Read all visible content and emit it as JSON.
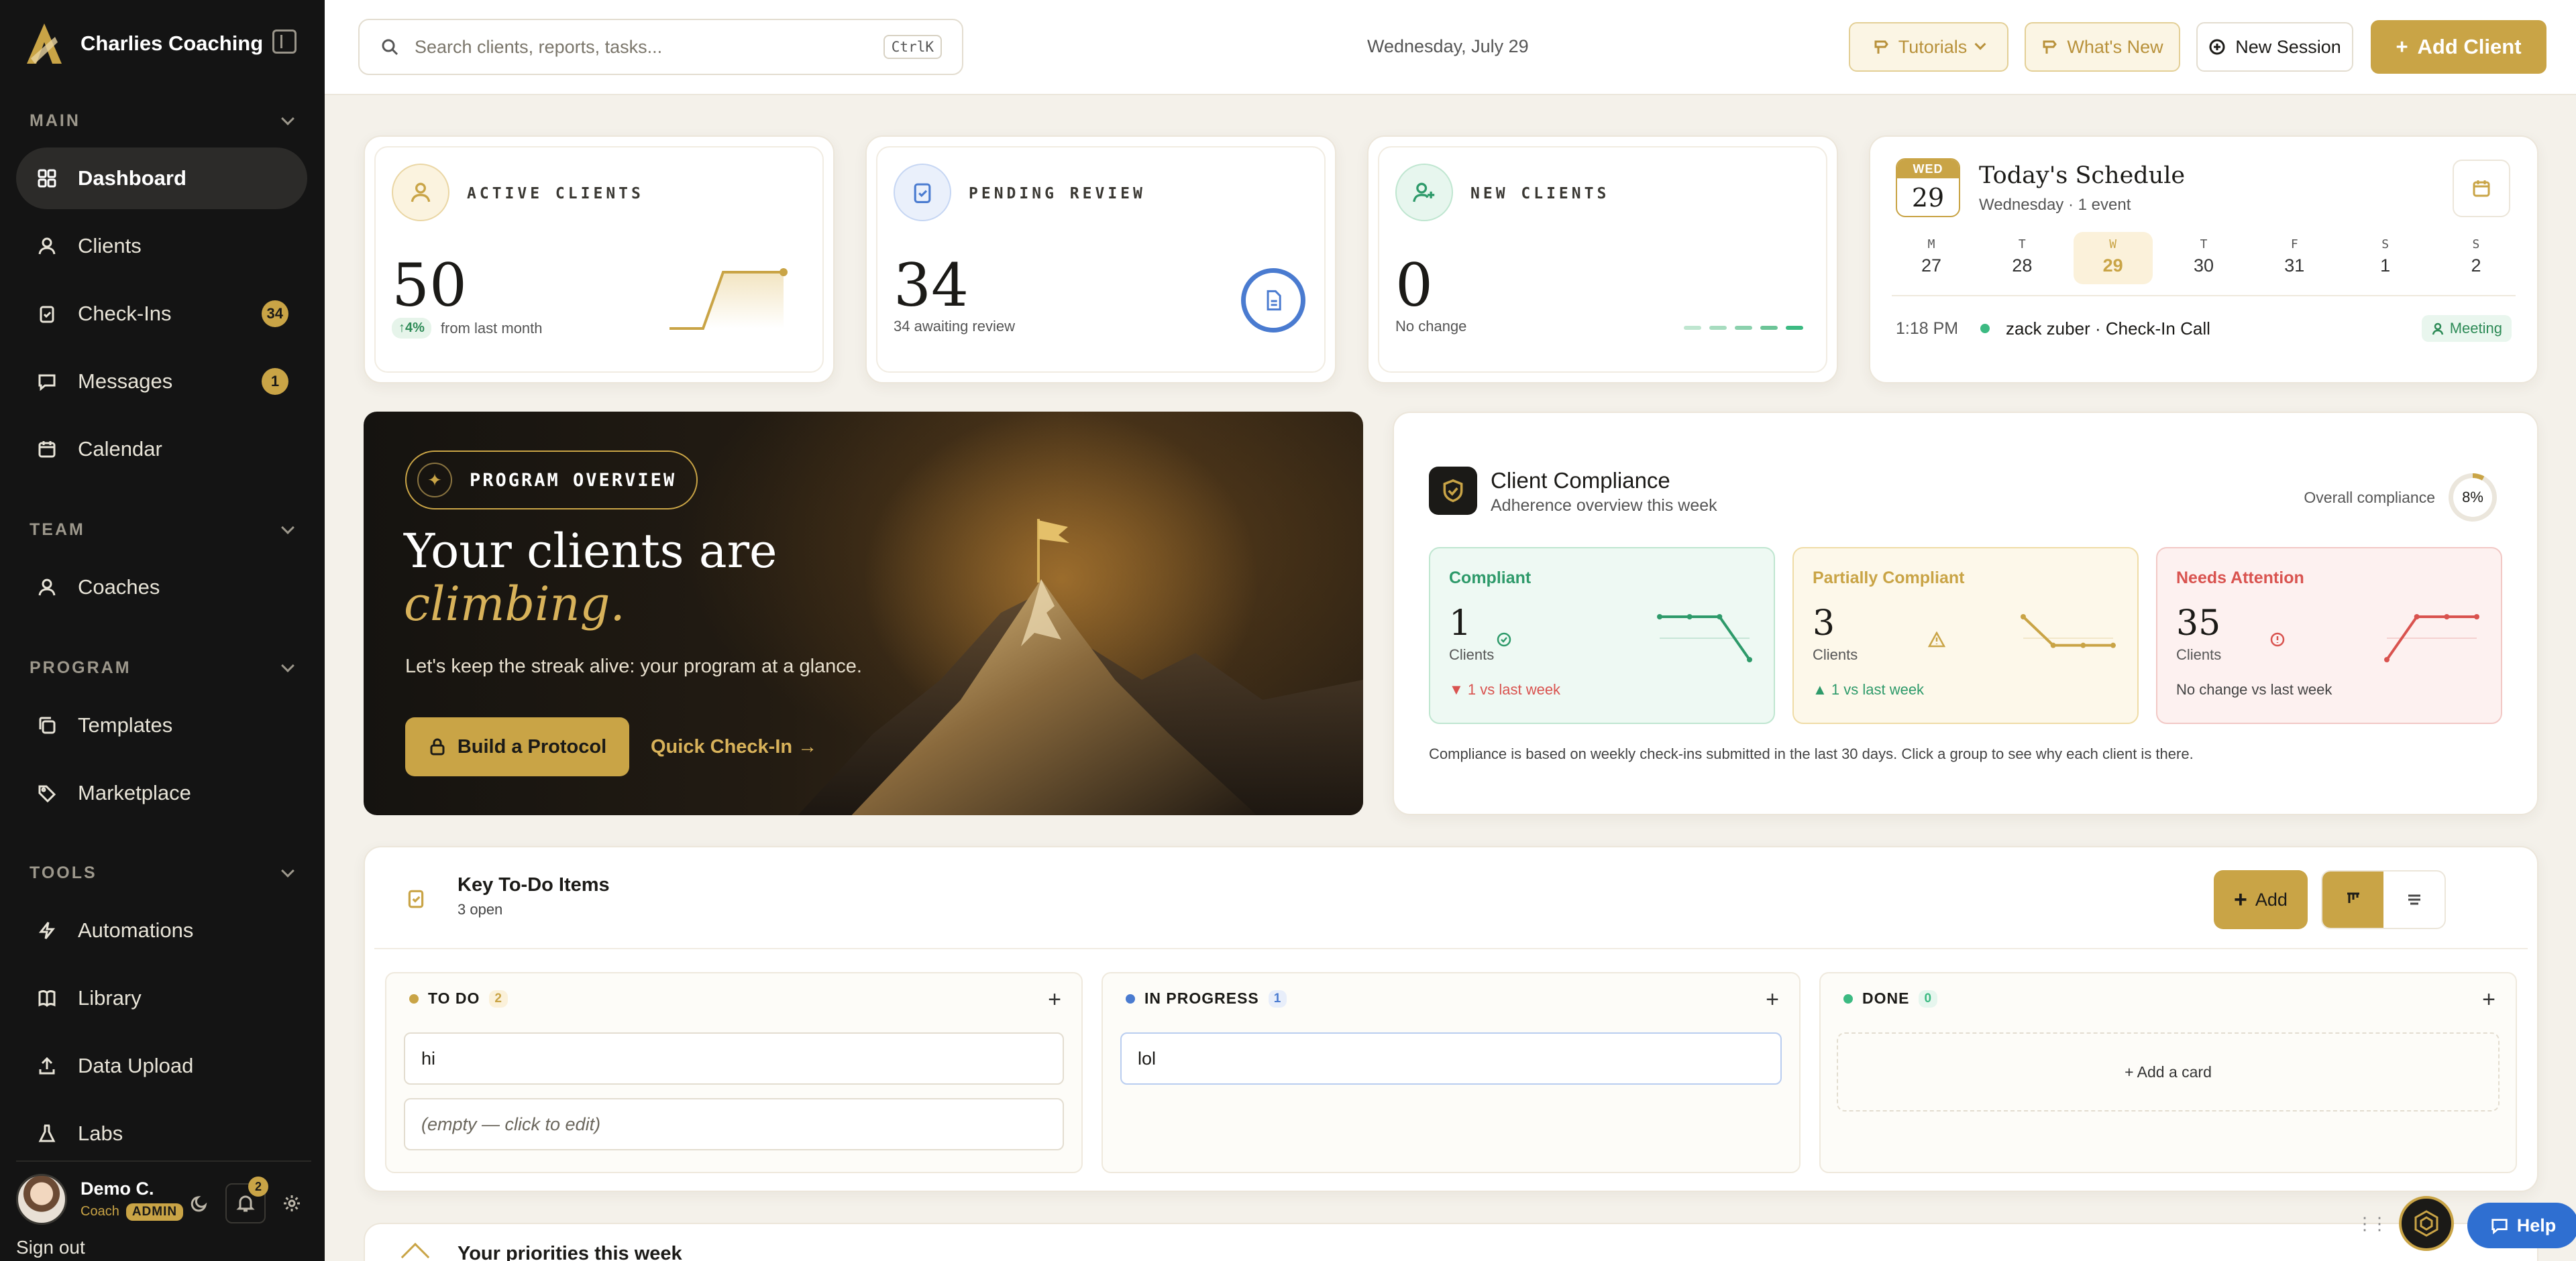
{
  "app": {
    "name": "Charlies Coaching"
  },
  "sidebar": {
    "sections": [
      {
        "title": "MAIN"
      },
      {
        "title": "TEAM"
      },
      {
        "title": "PROGRAM"
      },
      {
        "title": "TOOLS"
      }
    ],
    "items": [
      {
        "label": "Dashboard",
        "icon": "grid-icon",
        "active": true
      },
      {
        "label": "Clients",
        "icon": "users-icon"
      },
      {
        "label": "Check-Ins",
        "icon": "clipboard-check-icon",
        "badge": "34"
      },
      {
        "label": "Messages",
        "icon": "chat-icon",
        "badge": "1"
      },
      {
        "label": "Calendar",
        "icon": "calendar-icon"
      },
      {
        "label": "Coaches",
        "icon": "users-icon"
      },
      {
        "label": "Templates",
        "icon": "copy-icon"
      },
      {
        "label": "Marketplace",
        "icon": "tag-icon"
      },
      {
        "label": "Automations",
        "icon": "lightning-icon"
      },
      {
        "label": "Library",
        "icon": "book-icon"
      },
      {
        "label": "Data Upload",
        "icon": "upload-icon"
      },
      {
        "label": "Labs",
        "icon": "flask-icon"
      }
    ],
    "user": {
      "name": "Demo C.",
      "role": "Coach",
      "badge": "ADMIN",
      "notifications": "2"
    },
    "sign_out": "Sign out"
  },
  "topbar": {
    "search_placeholder": "Search clients, reports, tasks...",
    "shortcut": "CtrlK",
    "date": "Wednesday, July 29",
    "tutorials": "Tutorials",
    "whats_new": "What's New",
    "new_session": "New Session",
    "add_client": "Add Client"
  },
  "stats": [
    {
      "label": "ACTIVE CLIENTS",
      "value": "50",
      "trend": "↑4%",
      "sub": "from last month",
      "icon": "users-icon",
      "accent": "#c9a446"
    },
    {
      "label": "PENDING REVIEW",
      "value": "34",
      "sub": "34 awaiting review",
      "icon": "clipboard-check-icon",
      "accent": "#4a7bd0"
    },
    {
      "label": "NEW CLIENTS",
      "value": "0",
      "sub": "No change",
      "icon": "user-plus-icon",
      "accent": "#3cba82"
    }
  ],
  "schedule": {
    "title": "Today's Schedule",
    "subtitle": "Wednesday · 1 event",
    "chip_dow": "WED",
    "chip_day": "29",
    "week": [
      {
        "d": "M",
        "n": "27"
      },
      {
        "d": "T",
        "n": "28"
      },
      {
        "d": "W",
        "n": "29",
        "today": true
      },
      {
        "d": "T",
        "n": "30"
      },
      {
        "d": "F",
        "n": "31"
      },
      {
        "d": "S",
        "n": "1"
      },
      {
        "d": "S",
        "n": "2"
      }
    ],
    "events": [
      {
        "time": "1:18 PM",
        "title": "zack zuber · Check-In Call",
        "tag": "Meeting"
      }
    ]
  },
  "hero": {
    "badge": "PROGRAM OVERVIEW",
    "headline_1": "Your clients are",
    "headline_2": "climbing.",
    "body": "Let's keep the streak alive: your program at a glance.",
    "primary_cta": "Build a Protocol",
    "secondary_cta": "Quick Check-In →"
  },
  "compliance": {
    "title": "Client Compliance",
    "subtitle": "Adherence overview this week",
    "overall_label": "Overall compliance",
    "overall_value": "8%",
    "overall_pct": 8,
    "groups": [
      {
        "name": "Compliant",
        "value": "1",
        "unit": "Clients",
        "delta": "▼ 1 vs last week",
        "color": "#2e9a6a",
        "trend": [
          2,
          2,
          2,
          0
        ]
      },
      {
        "name": "Partially Compliant",
        "value": "3",
        "unit": "Clients",
        "delta": "▲ 1 vs last week",
        "color": "#c9a446",
        "trend": [
          3,
          1,
          1,
          1
        ]
      },
      {
        "name": "Needs Attention",
        "value": "35",
        "unit": "Clients",
        "delta": "No change vs last week",
        "color": "#d9534f",
        "trend": [
          0,
          3,
          3,
          3
        ]
      }
    ],
    "note": "Compliance is based on weekly check-ins submitted in the last 30 days. Click a group to see why each client is there."
  },
  "todo": {
    "title": "Key To-Do Items",
    "subtitle": "3 open",
    "add_label": "Add",
    "columns": [
      {
        "name": "TO DO",
        "count": "2",
        "color": "#c9a446",
        "cards": [
          "hi",
          "(empty — click to edit)"
        ]
      },
      {
        "name": "IN PROGRESS",
        "count": "1",
        "color": "#4a7bd0",
        "cards": [
          "lol"
        ]
      },
      {
        "name": "DONE",
        "count": "0",
        "color": "#3cba82",
        "cards": [],
        "empty_label": "+ Add a card"
      }
    ]
  },
  "priorities": {
    "title": "Your priorities this week"
  },
  "help": {
    "label": "Help"
  }
}
